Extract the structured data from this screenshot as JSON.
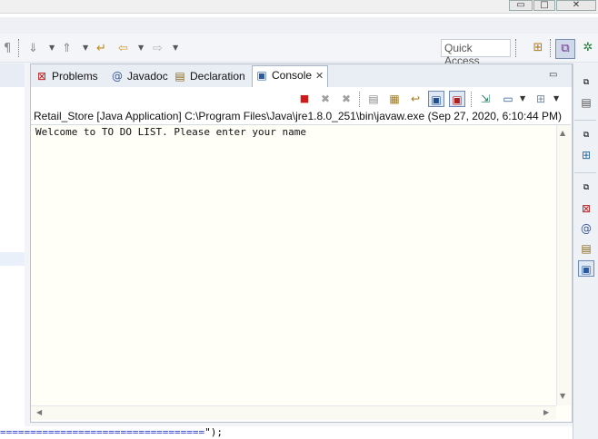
{
  "window": {
    "minimize": "▭",
    "maximize": "□",
    "close": "✕"
  },
  "toolbar": {
    "quick_access_label": "Quick Access",
    "icons": [
      "pilcrow-icon",
      "next-annotation-icon",
      "prev-annotation-icon",
      "last-edit-icon",
      "back-icon",
      "forward-icon"
    ],
    "perspectives": [
      "open-perspective-icon",
      "java-ee-perspective-icon",
      "debug-perspective-icon"
    ]
  },
  "tabs": [
    {
      "label": "Problems",
      "icon": "problems-icon"
    },
    {
      "label": "Javadoc",
      "icon": "javadoc-icon"
    },
    {
      "label": "Declaration",
      "icon": "declaration-icon"
    },
    {
      "label": "Console",
      "icon": "console-icon",
      "active": true
    }
  ],
  "console": {
    "process_label": "Retail_Store [Java Application] C:\\Program Files\\Java\\jre1.8.0_251\\bin\\javaw.exe (Sep 27, 2020, 6:10:44 PM)",
    "output": "Welcome to TO DO LIST. Please enter your name",
    "toolbar": [
      "terminate-icon",
      "remove-launch-icon",
      "remove-all-icon",
      "clear-console-icon",
      "scroll-lock-icon",
      "word-wrap-icon",
      "show-stdout-icon",
      "show-stderr-icon",
      "pin-console-icon",
      "display-console-icon",
      "open-console-icon"
    ]
  },
  "editor": {
    "bottom_line": "==================================",
    "bottom_line_tail": "\");"
  },
  "colors": {
    "terminate": "#d01a1a",
    "view_border": "#b9c2cf",
    "console_bg": "#fffff8"
  }
}
